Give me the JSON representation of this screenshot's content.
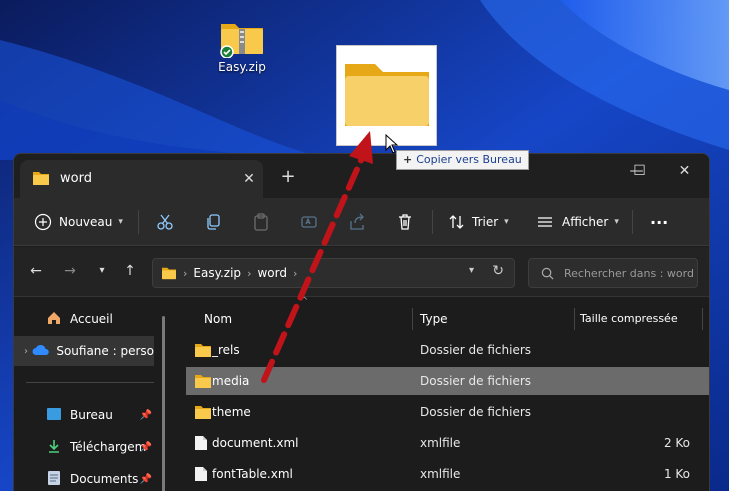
{
  "desktop": {
    "icon_label": "Easy.zip"
  },
  "drag": {
    "tooltip_action": "Copier vers",
    "tooltip_target": "Bureau",
    "plus": "+"
  },
  "window": {
    "tab_title": "word",
    "tab_close": "✕",
    "new_tab": "+",
    "controls": {
      "minimize": "—",
      "maximize": "☐",
      "close": "✕"
    }
  },
  "toolbar": {
    "new_label": "Nouveau",
    "sort_label": "Trier",
    "view_label": "Afficher",
    "more": "···"
  },
  "address": {
    "crumbs": [
      "Easy.zip",
      "word"
    ],
    "search_placeholder": "Rechercher dans : word"
  },
  "sidebar": {
    "items": [
      {
        "label": "Accueil"
      },
      {
        "label": "Soufiane : perso"
      },
      {
        "label": "Bureau"
      },
      {
        "label": "Téléchargem"
      },
      {
        "label": "Documents"
      }
    ]
  },
  "columns": {
    "name": "Nom",
    "type": "Type",
    "size": "Taille compressée"
  },
  "files": [
    {
      "name": "_rels",
      "type": "Dossier de fichiers",
      "size": ""
    },
    {
      "name": "media",
      "type": "Dossier de fichiers",
      "size": ""
    },
    {
      "name": "theme",
      "type": "Dossier de fichiers",
      "size": ""
    },
    {
      "name": "document.xml",
      "type": "xmlfile",
      "size": "2 Ko"
    },
    {
      "name": "fontTable.xml",
      "type": "xmlfile",
      "size": "1 Ko"
    }
  ],
  "colors": {
    "accent": "#4cc2ff",
    "folder": "#f5c542",
    "arrow": "#c0141a"
  }
}
